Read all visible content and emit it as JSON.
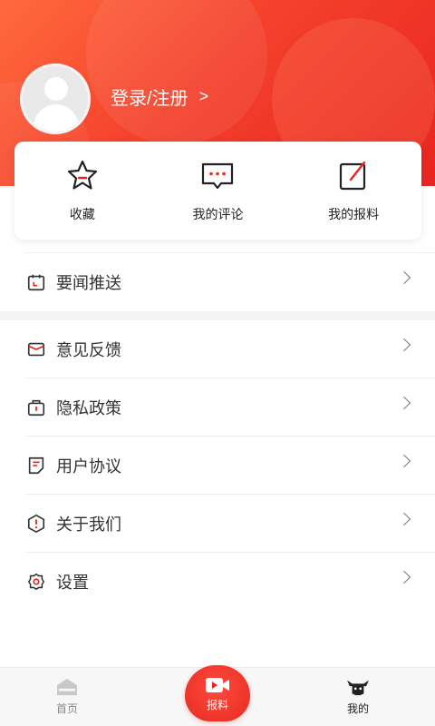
{
  "header": {
    "login_label": "登录/注册",
    "chevron": ">"
  },
  "quick": [
    {
      "label": "收藏",
      "icon": "star-icon"
    },
    {
      "label": "我的评论",
      "icon": "comment-icon"
    },
    {
      "label": "我的报料",
      "icon": "edit-icon"
    }
  ],
  "menu": [
    {
      "label": "要闻推送",
      "icon": "calendar-icon"
    },
    {
      "label": "意见反馈",
      "icon": "mail-icon"
    },
    {
      "label": "隐私政策",
      "icon": "lock-icon"
    },
    {
      "label": "用户协议",
      "icon": "document-icon"
    },
    {
      "label": "关于我们",
      "icon": "info-icon"
    },
    {
      "label": "设置",
      "icon": "gear-icon"
    }
  ],
  "tabs": {
    "home": "首页",
    "report": "报料",
    "mine": "我的"
  },
  "colors": {
    "accent": "#e8251f",
    "text": "#333333"
  }
}
